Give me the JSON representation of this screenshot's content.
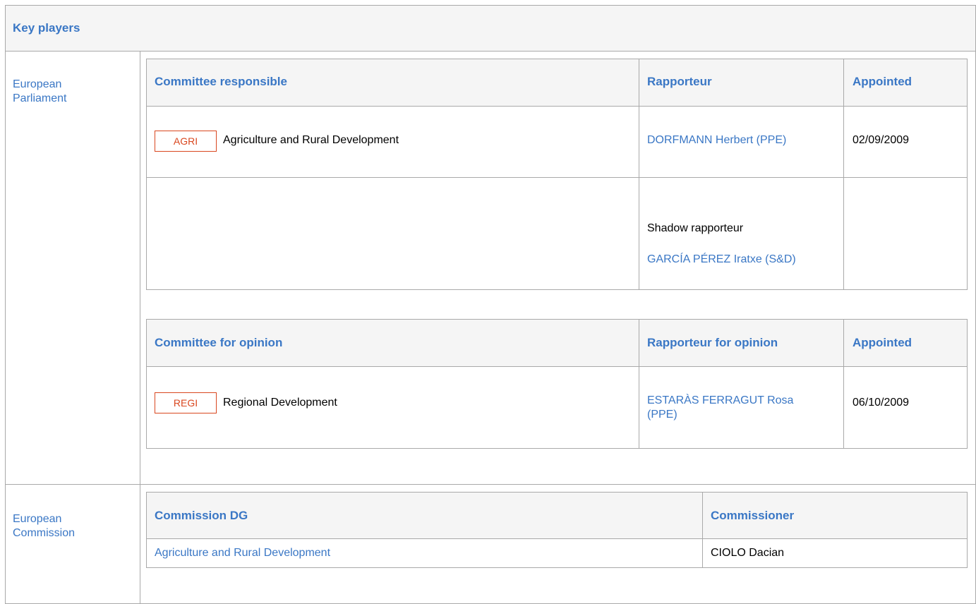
{
  "key_players": {
    "title": "Key players"
  },
  "european_parliament": {
    "label": "European Parliament",
    "responsible_table": {
      "headers": {
        "committee": "Committee responsible",
        "rapporteur": "Rapporteur",
        "appointed": "Appointed"
      },
      "row": {
        "badge": "AGRI",
        "committee_name": "Agriculture and Rural Development",
        "rapporteur": "DORFMANN Herbert (PPE)",
        "appointed": "02/09/2009"
      },
      "shadow": {
        "label": "Shadow rapporteur",
        "name": "GARCÍA PÉREZ Iratxe (S&D)"
      }
    },
    "opinion_table": {
      "headers": {
        "committee": "Committee for opinion",
        "rapporteur": "Rapporteur for opinion",
        "appointed": "Appointed"
      },
      "row": {
        "badge": "REGI",
        "committee_name": "Regional Development",
        "rapporteur": "ESTARÀS FERRAGUT Rosa (PPE)",
        "appointed": "06/10/2009"
      }
    }
  },
  "european_commission": {
    "label": "European Commission",
    "headers": {
      "dg": "Commission DG",
      "commissioner": "Commissioner"
    },
    "row": {
      "dg": "Agriculture and Rural Development",
      "commissioner": "CIOLO Dacian"
    }
  },
  "colors": {
    "link": "#3a77c5",
    "badge": "#d9471f",
    "header_bg": "#f5f5f5",
    "border": "#a9a9a9"
  }
}
